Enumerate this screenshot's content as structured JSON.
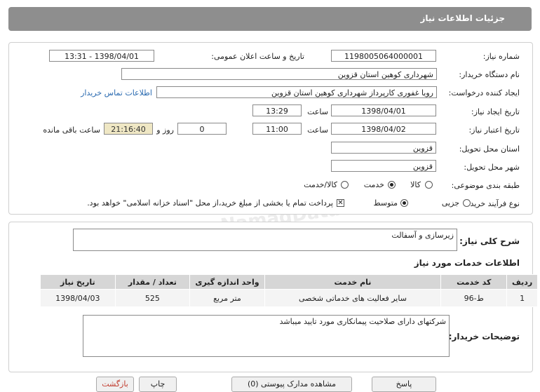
{
  "header": {
    "title": "جزئیات اطلاعات نیاز"
  },
  "form": {
    "need_number_label": "شماره نیاز:",
    "need_number": "1198005064000001",
    "announce_label": "تاریخ و ساعت اعلان عمومی:",
    "announce_value": "1398/04/01 - 13:31",
    "buyer_org_label": "نام دستگاه خریدار:",
    "buyer_org": "شهرداری کوهین استان قزوین",
    "requester_label": "ایجاد کننده درخواست:",
    "requester": "رویا غفوری کارپرداز شهرداری کوهین استان قزوین",
    "contact_link": "اطلاعات تماس خریدار",
    "created_label": "تاریخ ایجاد نیاز:",
    "created_date": "1398/04/01",
    "time_label": "ساعت",
    "created_time": "13:29",
    "validity_label": "تاریخ اعتبار نیاز:",
    "validity_date": "1398/04/02",
    "validity_time": "11:00",
    "days_value": "0",
    "days_label": "روز و",
    "remaining_time": "21:16:40",
    "remaining_label": "ساعت باقی مانده",
    "province_label": "استان محل تحویل:",
    "province": "قزوین",
    "city_label": "شهر محل تحویل:",
    "city": "قزوین",
    "category_label": "طبقه بندی موضوعی:",
    "category_options": [
      "کالا",
      "خدمت",
      "کالا/خدمت"
    ],
    "category_selected": "خدمت",
    "process_label": "نوع فرآیند خرید :",
    "process_options": [
      "جزیی",
      "متوسط"
    ],
    "process_selected": "متوسط",
    "payment_note": "پرداخت تمام یا بخشی از مبلغ خرید،از محل \"اسناد خزانه اسلامی\" خواهد بود."
  },
  "summary": {
    "label": "شرح کلی نیاز:",
    "value": "زیرسازی و آسفالت"
  },
  "services": {
    "title": "اطلاعات خدمات مورد نیاز",
    "columns": [
      "ردیف",
      "کد خدمت",
      "نام خدمت",
      "واحد اندازه گیری",
      "تعداد / مقدار",
      "تاریخ نیاز"
    ],
    "rows": [
      [
        "1",
        "ط-96",
        "سایر فعالیت های خدماتی شخصی",
        "متر مربع",
        "525",
        "1398/04/03"
      ]
    ]
  },
  "buyer_notes": {
    "label": "توضیحات خریدار:",
    "value": "شرکتهای دارای صلاحیت پیمانکاری مورد تایید میباشد"
  },
  "footer": {
    "buttons": [
      "بازگشت",
      "چاپ",
      "مشاهده مدارک پیوستی (0)",
      "پاسخ"
    ]
  }
}
